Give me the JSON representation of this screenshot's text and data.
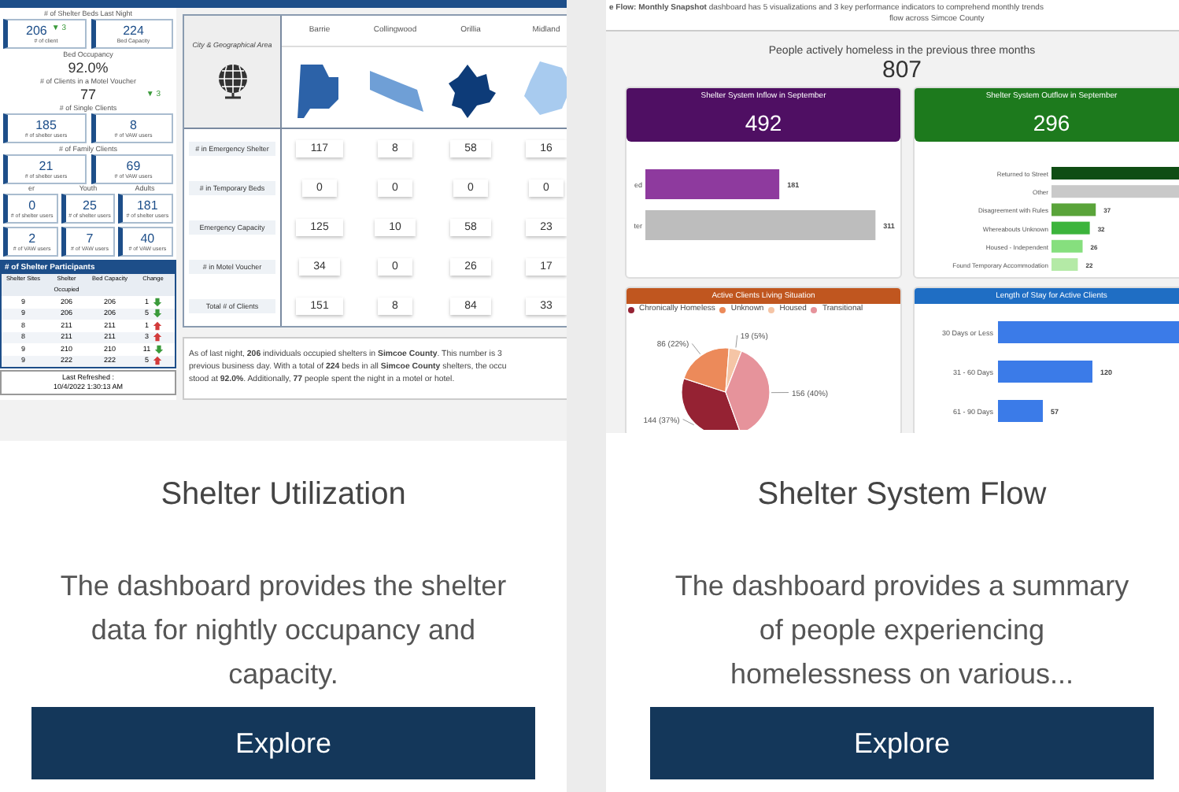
{
  "cards": [
    {
      "title": "Shelter Utilization",
      "description": "The dashboard provides the shelter data for nightly occupancy and capacity.",
      "button": "Explore",
      "preview": {
        "kind": "utilization",
        "sections": [
          {
            "kind": "tiles",
            "label": "# of Shelter Beds Last Night",
            "tiles": [
              {
                "value": "206",
                "caption": "# of client",
                "change": "▼ 3"
              },
              {
                "value": "224",
                "caption": "Bed Capacity"
              }
            ]
          },
          {
            "kind": "figure",
            "label": "Bed Occupancy",
            "value": "92.0%"
          },
          {
            "kind": "figure",
            "label": "# of Clients in a Motel Voucher",
            "value": "77",
            "change": "▼ 3"
          },
          {
            "kind": "tiles",
            "label": "# of Single Clients",
            "tiles": [
              {
                "value": "185",
                "caption": "# of shelter users"
              },
              {
                "value": "8",
                "caption": "# of VAW users"
              }
            ]
          },
          {
            "kind": "tiles",
            "label": "# of Family Clients",
            "tiles": [
              {
                "value": "21",
                "caption": "# of shelter users"
              },
              {
                "value": "69",
                "caption": "# of VAW users"
              }
            ]
          },
          {
            "kind": "grid",
            "headers": [
              "er",
              "Youth",
              "Adults"
            ],
            "tiles": [
              {
                "value": "0",
                "caption": "# of shelter users"
              },
              {
                "value": "25",
                "caption": "# of shelter users"
              },
              {
                "value": "181",
                "caption": "# of shelter users"
              },
              {
                "value": "2",
                "caption": "# of VAW users"
              },
              {
                "value": "7",
                "caption": "# of VAW users"
              },
              {
                "value": "40",
                "caption": "# of VAW users"
              }
            ]
          }
        ],
        "participants": {
          "title": "# of Shelter Participants",
          "columns": [
            "Shelter Sites",
            "Shelter Occupied",
            "Bed Capacity",
            "Change"
          ],
          "rows": [
            {
              "cells": [
                "9",
                "206",
                "206",
                "1"
              ],
              "kind": "down"
            },
            {
              "cells": [
                "9",
                "206",
                "206",
                "5"
              ],
              "kind": "down"
            },
            {
              "cells": [
                "8",
                "211",
                "211",
                "1"
              ],
              "kind": "up"
            },
            {
              "cells": [
                "8",
                "211",
                "211",
                "3"
              ],
              "kind": "up"
            },
            {
              "cells": [
                "9",
                "210",
                "210",
                "11"
              ],
              "kind": "down"
            },
            {
              "cells": [
                "9",
                "222",
                "222",
                "5"
              ],
              "kind": "up"
            }
          ]
        },
        "refreshed": [
          "Last Refreshed :",
          "10/4/2022 1:30:13 AM"
        ],
        "area_heading": "City & Geographical Area",
        "cities": [
          {
            "name": "Barrie",
            "color": "#2c62a8"
          },
          {
            "name": "Collingwood",
            "color": "#6f9fd6"
          },
          {
            "name": "Orillia",
            "color": "#0d3b78"
          },
          {
            "name": "Midland",
            "color": "#a8cbef"
          }
        ],
        "rows": [
          {
            "label": "# in Emergency Shelter",
            "values": [
              "117",
              "8",
              "58",
              "16"
            ]
          },
          {
            "label": "# in Temporary Beds",
            "values": [
              "0",
              "0",
              "0",
              "0"
            ]
          },
          {
            "label": "Emergency Capacity",
            "values": [
              "125",
              "10",
              "58",
              "23"
            ]
          },
          {
            "label": "# in Motel Voucher",
            "values": [
              "34",
              "0",
              "26",
              "17"
            ]
          },
          {
            "label": "Total # of Clients",
            "values": [
              "151",
              "8",
              "84",
              "33"
            ]
          }
        ],
        "summary_lines": [
          "As of last night, **206** individuals occupied shelters in **Simcoe County**. This number is 3",
          "previous business day. With a total of **224** beds in all **Simcoe County** shelters, the occu",
          "stood at **92.0%**. Additionally, **77** people spent the night in a motel or hotel."
        ]
      }
    },
    {
      "title": "Shelter System Flow",
      "description": "The dashboard provides a summary of people experiencing homelessness on various...",
      "button": "Explore",
      "preview": {
        "kind": "flow",
        "intro_lines": [
          "**e Flow: Monthly Snapshot** dashboard has 5 visualizations and 3 key performance indicators to comprehend monthly trends",
          "flow across Simcoe County"
        ],
        "headline": {
          "label": "People actively homeless in the previous three months",
          "value": "807"
        },
        "panels": [
          {
            "title": "Shelter System Inflow in September",
            "value": "492",
            "color": "#4f0f63",
            "chart_data": {
              "type": "bar",
              "orientation": "horizontal",
              "categories": [
                "ed",
                "ter"
              ],
              "values": [
                181,
                311
              ],
              "data_labels": true
            }
          },
          {
            "title": "Shelter System Outflow in September",
            "value": "296",
            "color": "#1d7a1d",
            "chart_data": {
              "type": "bar",
              "orientation": "horizontal",
              "categories": [
                "Returned to Street",
                "Other",
                "Disagreement with Rules",
                "Whereabouts Unknown",
                "Housed - Independent",
                "Found Temporary Accommodation"
              ],
              "values": [
                null,
                null,
                37,
                32,
                26,
                22
              ],
              "data_labels": true
            }
          },
          {
            "title": "Active Clients Living Situation",
            "color": "#c0561f",
            "chart_data": {
              "type": "pie",
              "categories": [
                "Chronically Homeless",
                "Unknown",
                "Housed",
                "Transitional"
              ],
              "values": [
                144,
                86,
                19,
                156
              ],
              "value_labels": [
                "144 (37%)",
                "86 (22%)",
                "19 (5%)",
                "156 (40%)"
              ]
            }
          },
          {
            "title": "Length of Stay for Active Clients",
            "color": "#1f6ec4",
            "chart_data": {
              "type": "bar",
              "orientation": "horizontal",
              "categories": [
                "30 Days or Less",
                "31 - 60 Days",
                "61 - 90 Days"
              ],
              "values": [
                null,
                120,
                57
              ],
              "data_labels": true
            }
          }
        ]
      }
    }
  ]
}
